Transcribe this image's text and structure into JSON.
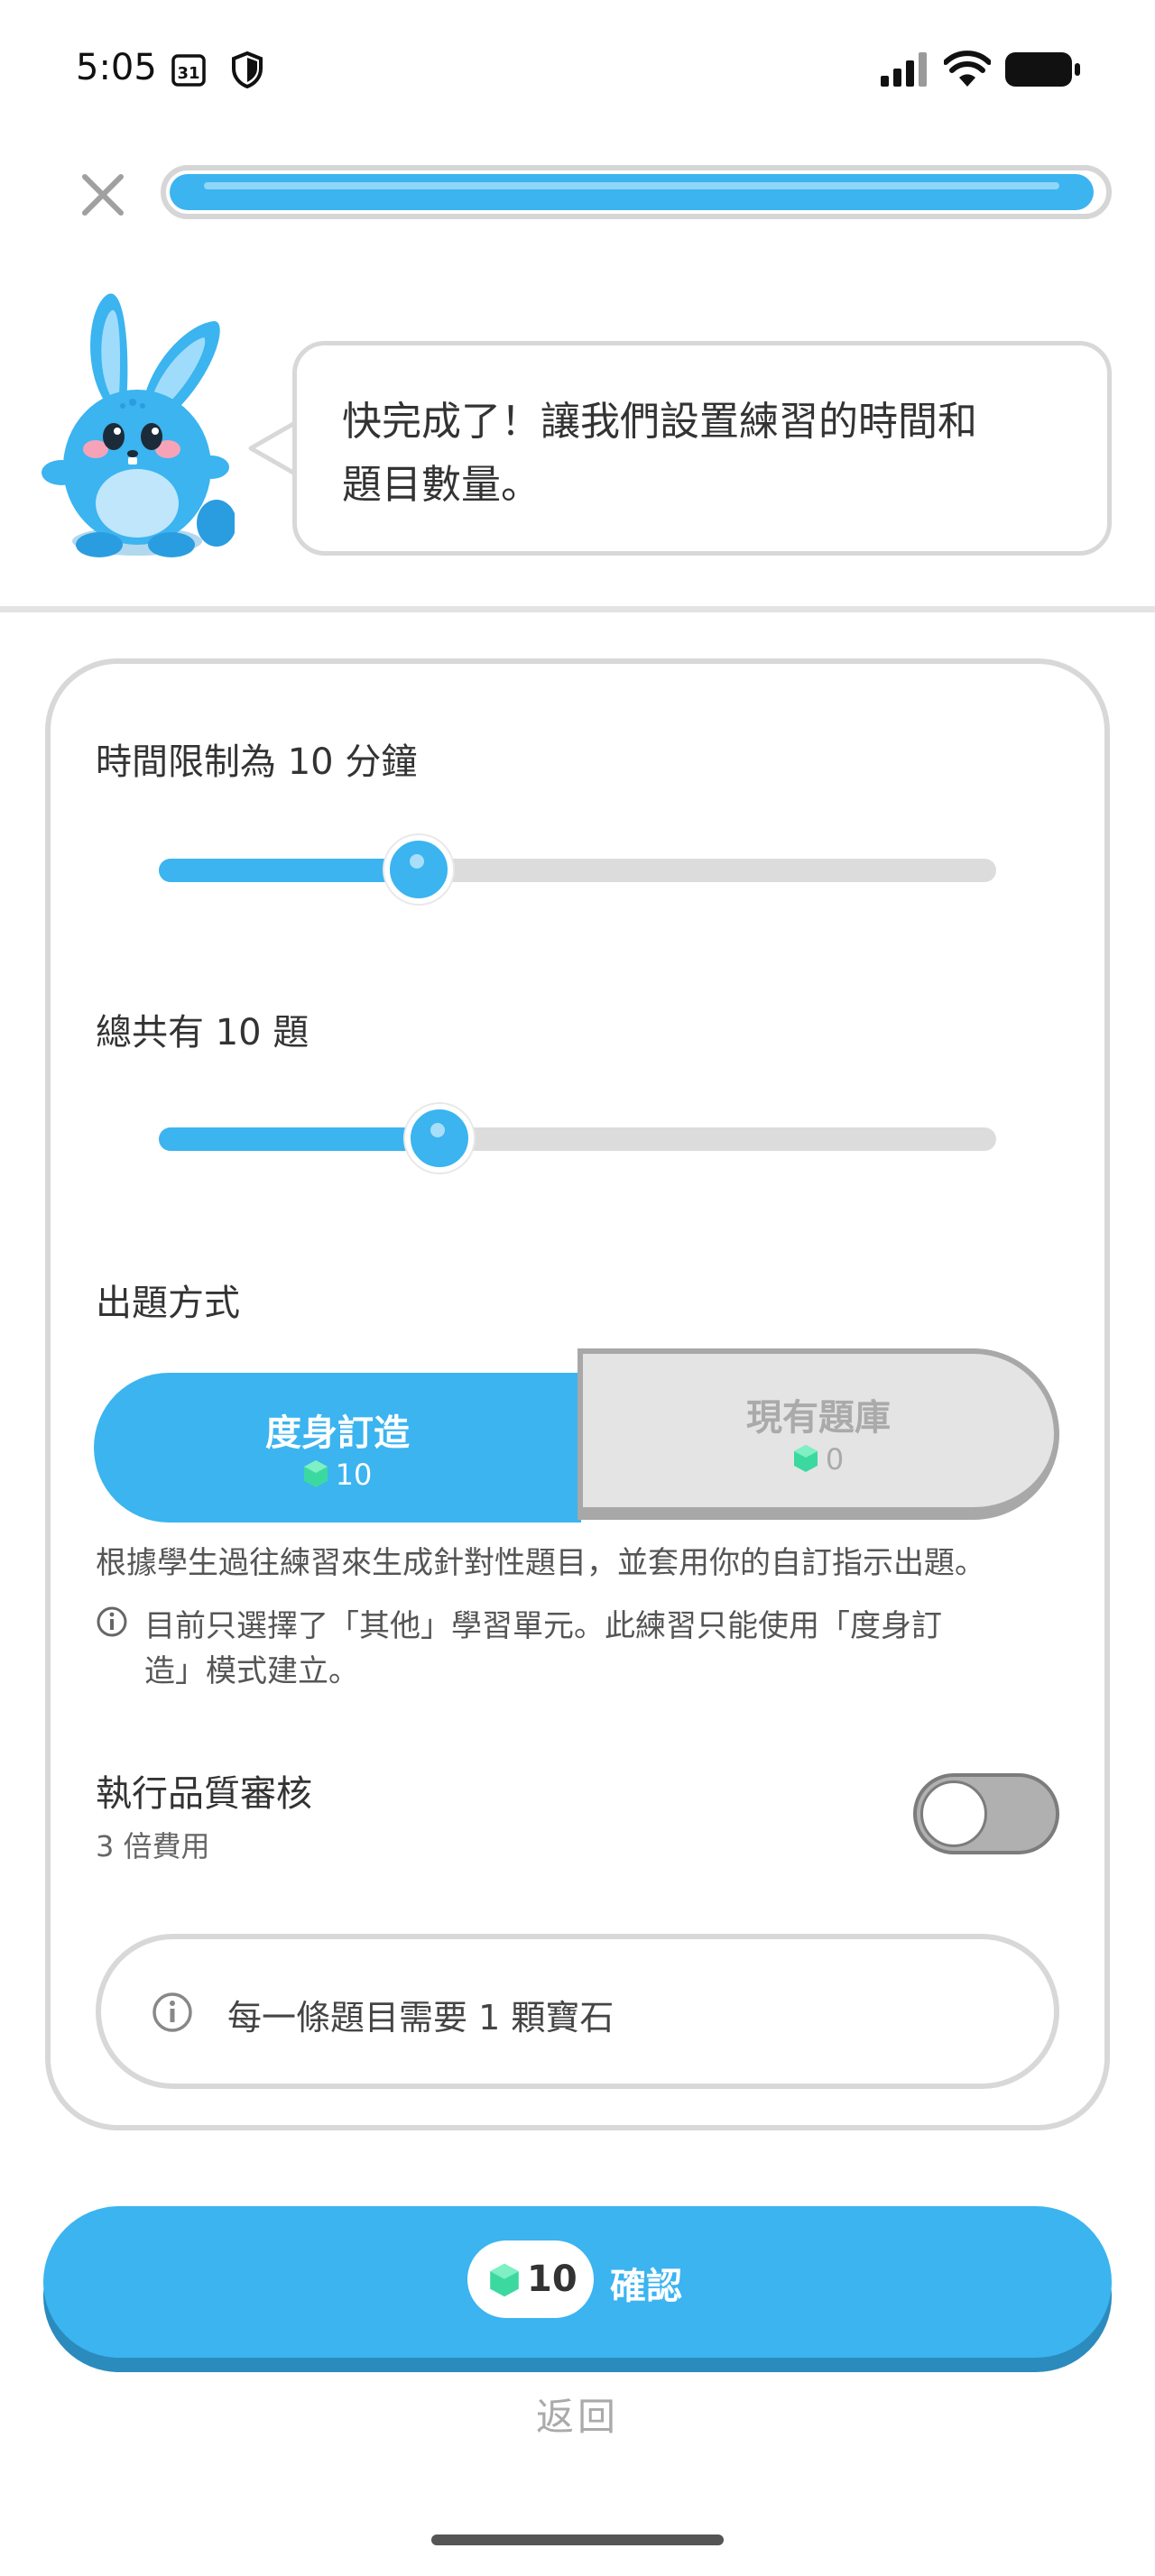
{
  "status_bar": {
    "time": "5:05",
    "calendar_day": "31"
  },
  "progress": {
    "fraction": 0.99
  },
  "speech_bubble": {
    "line1": "快完成了！讓我們設置練習的時間和",
    "line2": "題目數量。"
  },
  "time_limit": {
    "label": "時間限制為 10 分鐘",
    "slider_fraction": 0.31
  },
  "question_count": {
    "label": "總共有 10 題",
    "slider_fraction": 0.335
  },
  "question_mode": {
    "label": "出題方式",
    "options": [
      {
        "label": "度身訂造",
        "cost": "10",
        "selected": true
      },
      {
        "label": "現有題庫",
        "cost": "0",
        "selected": false
      }
    ],
    "description": "根據學生過往練習來生成針對性題目，並套用你的自訂指示出題。",
    "note_line1": "目前只選擇了「其他」學習單元。此練習只能使用「度身訂",
    "note_line2": "造」模式建立。"
  },
  "quality_review": {
    "label": "執行品質審核",
    "sublabel": "3 倍費用",
    "enabled": false
  },
  "info_pill": {
    "text": "每一條題目需要 1 顆寶石"
  },
  "confirm": {
    "cost": "10",
    "label": "確認"
  },
  "back": {
    "label": "返回"
  },
  "colors": {
    "accent": "#3bb4f0",
    "gem": "#3bd9a0",
    "border": "#d8d8d8",
    "disabled_segment": "#e4e4e4"
  }
}
